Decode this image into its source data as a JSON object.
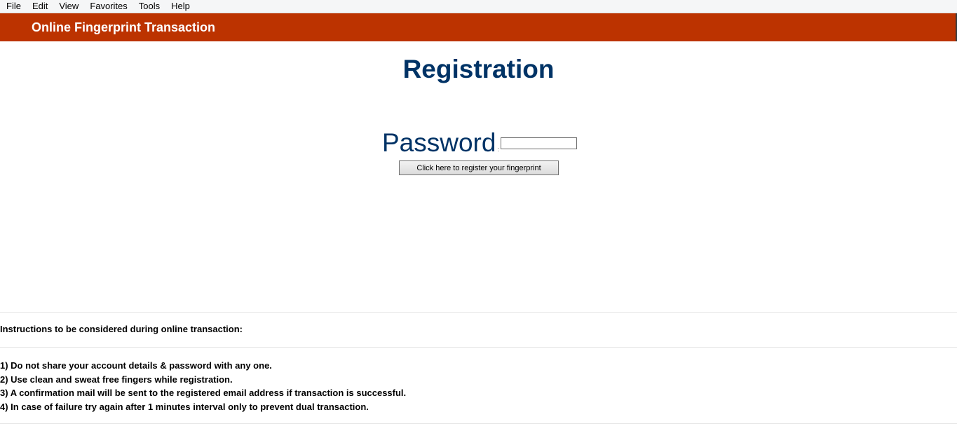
{
  "menu": {
    "items": [
      "File",
      "Edit",
      "View",
      "Favorites",
      "Tools",
      "Help"
    ]
  },
  "header": {
    "title": "Online Fingerprint Transaction",
    "background_color": "#bc3300"
  },
  "main": {
    "title": "Registration",
    "title_color": "#003366",
    "password_label": "Password",
    "password_colon": ":",
    "password_value": "",
    "register_button_label": "Click here to register your fingerprint"
  },
  "instructions": {
    "heading": "Instructions to be considered during online transaction:",
    "items": [
      "1) Do not share your account details & password with any one.",
      "2) Use clean and sweat free fingers while registration.",
      "3) A confirmation mail will be sent to the registered email address if transaction is successful.",
      "4) In case of failure try again after 1 minutes interval only to prevent dual transaction."
    ]
  }
}
